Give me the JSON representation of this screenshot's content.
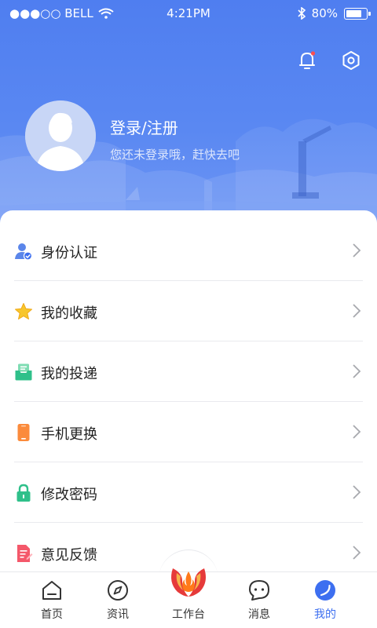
{
  "status_bar": {
    "carrier": "●●●○○ BELL",
    "time": "4:21PM",
    "battery": "80%",
    "battery_level": 0.8
  },
  "header": {
    "icons": [
      "bell-icon",
      "settings-hex-icon"
    ]
  },
  "user": {
    "title": "登录/注册",
    "subtitle": "您还未登录哦，赶快去吧"
  },
  "menu": {
    "items": [
      {
        "label": "身份认证",
        "icon": "identity-icon"
      },
      {
        "label": "我的收藏",
        "icon": "star-icon"
      },
      {
        "label": "我的投递",
        "icon": "delivery-icon"
      },
      {
        "label": "手机更换",
        "icon": "phone-icon"
      },
      {
        "label": "修改密码",
        "icon": "lock-icon"
      },
      {
        "label": "意见反馈",
        "icon": "feedback-icon"
      }
    ]
  },
  "tabbar": {
    "items": [
      {
        "label": "首页",
        "icon": "home-icon"
      },
      {
        "label": "资讯",
        "icon": "compass-icon"
      },
      {
        "label": "工作台",
        "icon": "workbench-logo-icon"
      },
      {
        "label": "消息",
        "icon": "message-icon"
      },
      {
        "label": "我的",
        "icon": "profile-icon"
      }
    ],
    "active_index": 4
  },
  "colors": {
    "accent": "#3d6ff0",
    "hero": "#4f7ef0"
  }
}
